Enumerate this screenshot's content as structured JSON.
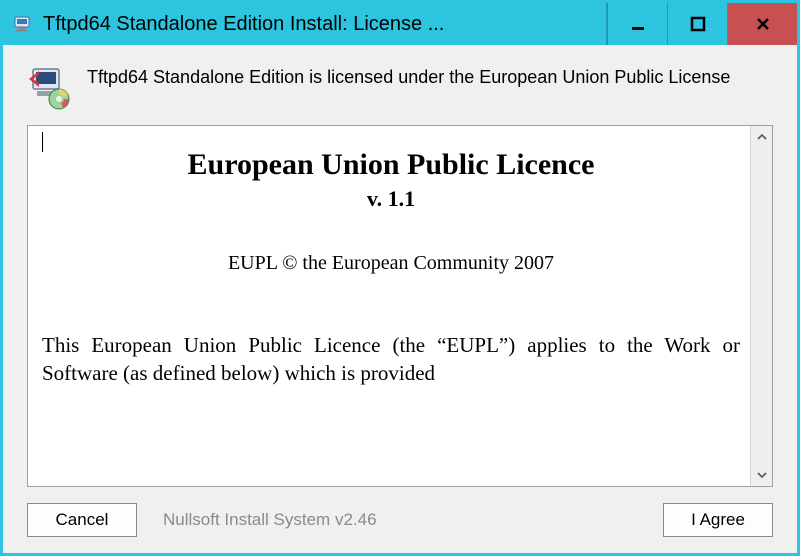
{
  "window": {
    "title": "Tftpd64 Standalone Edition Install: License ..."
  },
  "header": {
    "text": "Tftpd64 Standalone Edition is licensed under the European Union Public License"
  },
  "license": {
    "title": "European Union Public Licence",
    "version": "v. 1.1",
    "owner": "EUPL © the European Community 2007",
    "body": "This European Union Public Licence (the “EUPL”) applies to the Work or Software (as defined below) which is provided"
  },
  "footer": {
    "cancel_label": "Cancel",
    "agree_label": "I Agree",
    "installer": "Nullsoft Install System v2.46"
  }
}
